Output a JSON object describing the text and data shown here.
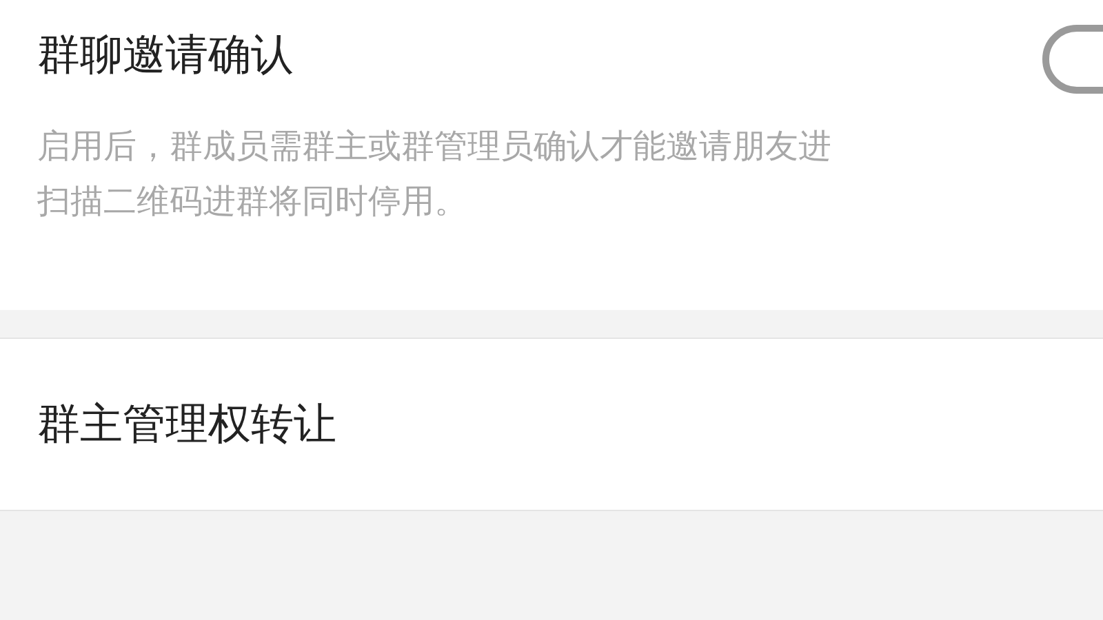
{
  "settings": [
    {
      "kind": "toggle",
      "title": "群聊邀请确认",
      "on": false,
      "description_lines": [
        "启用后，群成员需群主或群管理员确认才能邀请朋友进",
        "扫描二维码进群将同时停用。"
      ]
    },
    {
      "kind": "link",
      "title": "群主管理权转让"
    }
  ]
}
